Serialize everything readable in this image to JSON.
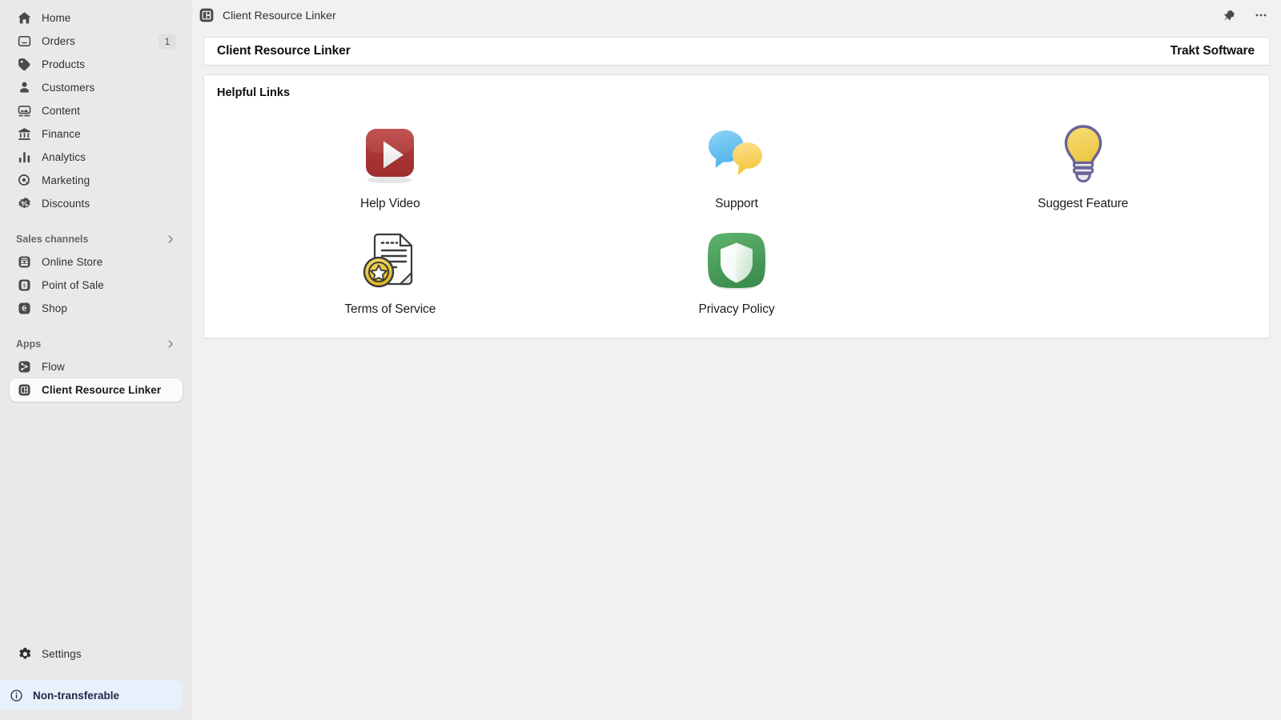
{
  "topbar": {
    "app_icon": "app-grid-icon",
    "title": "Client Resource Linker",
    "pin_label": "pin-icon",
    "more_label": "more-options-icon"
  },
  "sidebar": {
    "primary": [
      {
        "label": "Home",
        "icon": "home-icon"
      },
      {
        "label": "Orders",
        "icon": "orders-inbox-icon",
        "badge": "1"
      },
      {
        "label": "Products",
        "icon": "product-tag-icon"
      },
      {
        "label": "Customers",
        "icon": "customer-person-icon"
      },
      {
        "label": "Content",
        "icon": "content-media-icon"
      },
      {
        "label": "Finance",
        "icon": "finance-bank-icon"
      },
      {
        "label": "Analytics",
        "icon": "analytics-bars-icon"
      },
      {
        "label": "Marketing",
        "icon": "marketing-target-icon"
      },
      {
        "label": "Discounts",
        "icon": "discount-percent-icon"
      }
    ],
    "sales_channels": {
      "title": "Sales channels",
      "chevron": "chevron-right-icon",
      "items": [
        {
          "label": "Online Store",
          "icon": "online-store-icon"
        },
        {
          "label": "Point of Sale",
          "icon": "point-of-sale-icon"
        },
        {
          "label": "Shop",
          "icon": "shop-icon"
        }
      ]
    },
    "apps": {
      "title": "Apps",
      "chevron": "chevron-right-icon",
      "items": [
        {
          "label": "Flow",
          "icon": "flow-icon",
          "active": false
        },
        {
          "label": "Client Resource Linker",
          "icon": "client-resource-linker-icon",
          "active": true
        }
      ]
    },
    "settings": {
      "label": "Settings",
      "icon": "gear-icon"
    },
    "transfer_banner": {
      "label": "Non-transferable",
      "icon": "info-circle-icon"
    }
  },
  "main": {
    "title_card": {
      "app_name": "Client Resource Linker",
      "vendor": "Trakt Software"
    },
    "helpful_links": {
      "heading": "Helpful Links",
      "tiles": [
        {
          "label": "Help Video",
          "icon": "play-video-icon"
        },
        {
          "label": "Support",
          "icon": "speech-bubbles-icon"
        },
        {
          "label": "Suggest Feature",
          "icon": "lightbulb-icon"
        },
        {
          "label": "Terms of Service",
          "icon": "document-seal-icon"
        },
        {
          "label": "Privacy Policy",
          "icon": "shield-icon"
        }
      ]
    }
  },
  "colors": {
    "sidebar_bg": "#e9e9e9",
    "content_bg": "#f1f1f1",
    "card_bg": "#ffffff",
    "banner_bg": "#e8f0fb",
    "banner_text": "#1c2b47",
    "video_red": "#b03a3a",
    "support_blue": "#7ec8f0",
    "support_yellow": "#f5cf5c",
    "bulb_yellow": "#f2d35e",
    "bulb_outline": "#6b6496",
    "seal_gold": "#e8c93c",
    "shield_green": "#4aa35a"
  }
}
